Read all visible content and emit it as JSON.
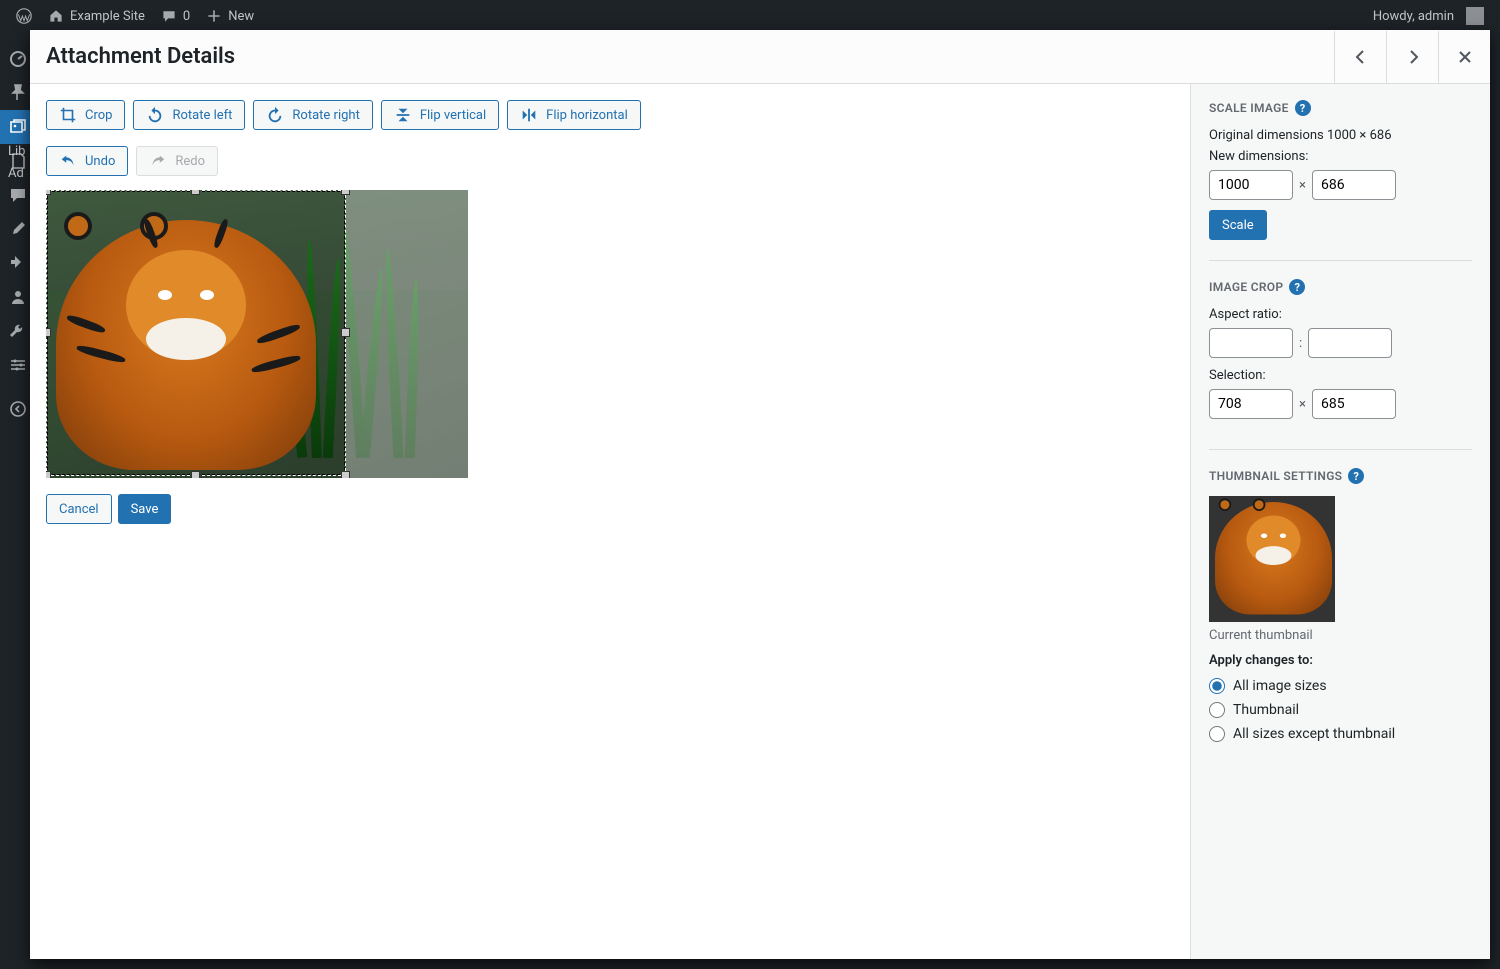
{
  "adminbar": {
    "site_name": "Example Site",
    "comments_count": "0",
    "new_label": "New",
    "howdy": "Howdy, admin"
  },
  "sidebar": {
    "partial_labels": {
      "library": "Lib",
      "add": "Ad"
    }
  },
  "modal": {
    "title": "Attachment Details"
  },
  "toolbar": {
    "crop": "Crop",
    "rotate_left": "Rotate left",
    "rotate_right": "Rotate right",
    "flip_vertical": "Flip vertical",
    "flip_horizontal": "Flip horizontal",
    "undo": "Undo",
    "redo": "Redo"
  },
  "actions": {
    "cancel": "Cancel",
    "save": "Save"
  },
  "scale": {
    "heading": "Scale Image",
    "original_dims_label": "Original dimensions 1000 × 686",
    "new_dims_label": "New dimensions:",
    "width": "1000",
    "height": "686",
    "button": "Scale"
  },
  "crop_panel": {
    "heading": "Image Crop",
    "aspect_ratio_label": "Aspect ratio:",
    "aspect_w": "",
    "aspect_h": "",
    "selection_label": "Selection:",
    "sel_w": "708",
    "sel_h": "685"
  },
  "thumbnail": {
    "heading": "Thumbnail Settings",
    "current_label": "Current thumbnail",
    "apply_label": "Apply changes to:",
    "options": {
      "all": "All image sizes",
      "thumb": "Thumbnail",
      "except": "All sizes except thumbnail"
    }
  }
}
